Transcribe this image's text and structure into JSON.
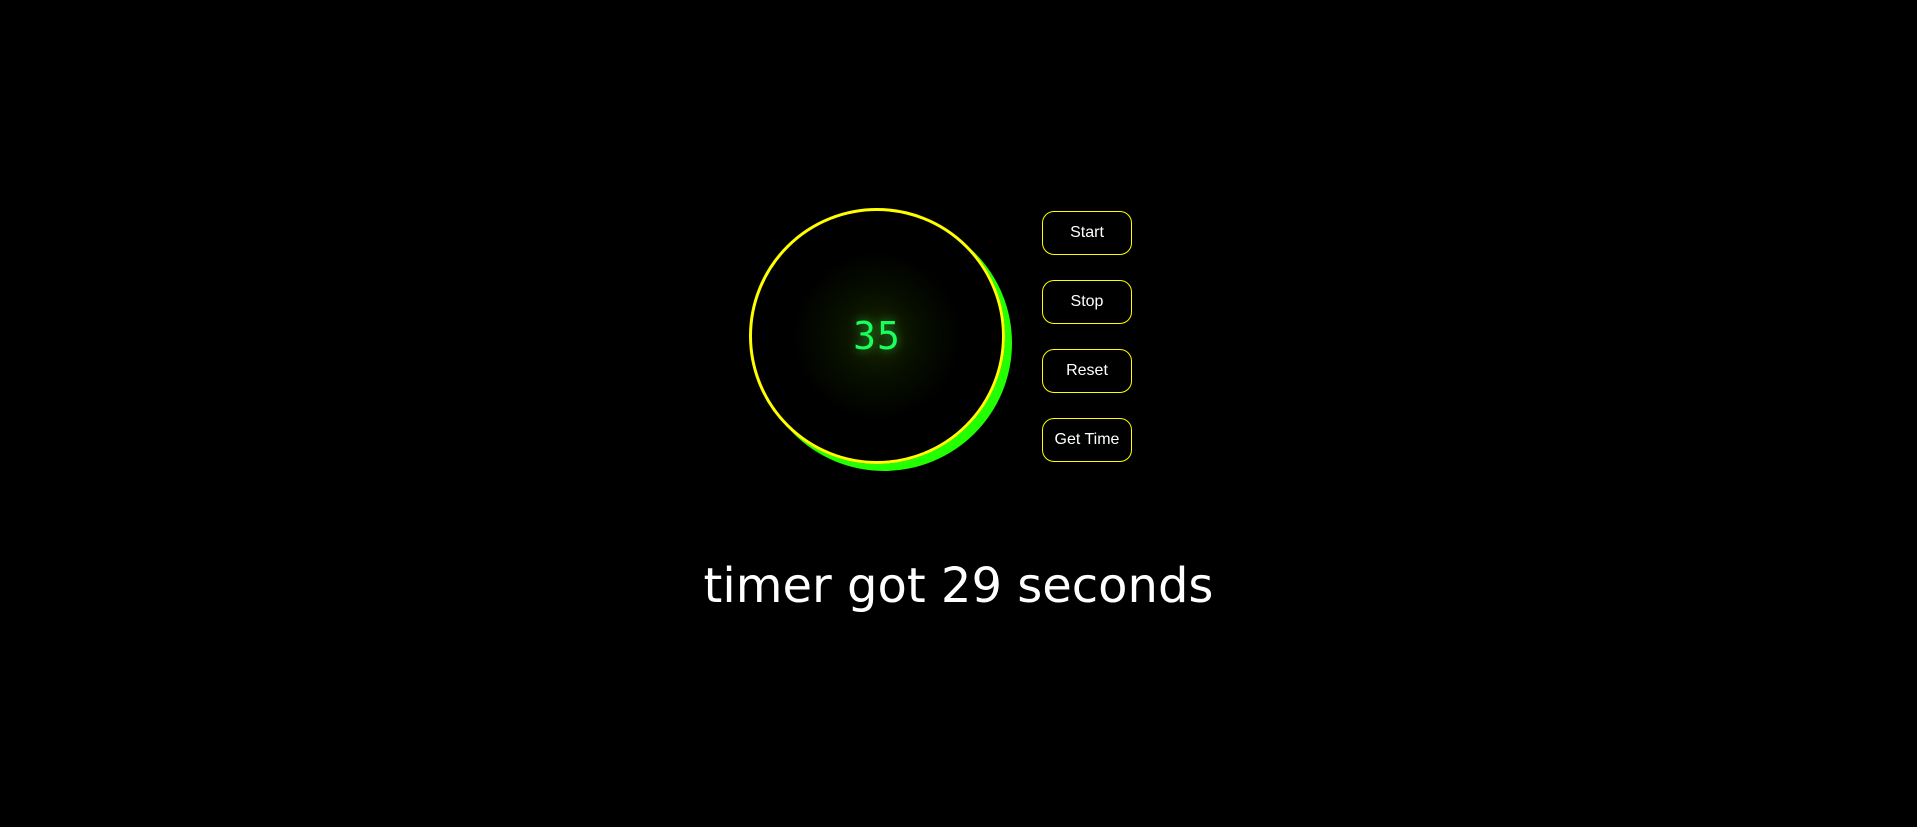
{
  "timer": {
    "display_value": "35"
  },
  "controls": {
    "start_label": "Start",
    "stop_label": "Stop",
    "reset_label": "Reset",
    "get_time_label": "Get Time"
  },
  "status": {
    "message": "timer got 29 seconds"
  },
  "colors": {
    "background": "#000000",
    "ring": "#ffff00",
    "ring_shadow": "#22ff00",
    "timer_text": "#1aff5a",
    "button_border": "#ffff00",
    "text": "#ffffff"
  }
}
